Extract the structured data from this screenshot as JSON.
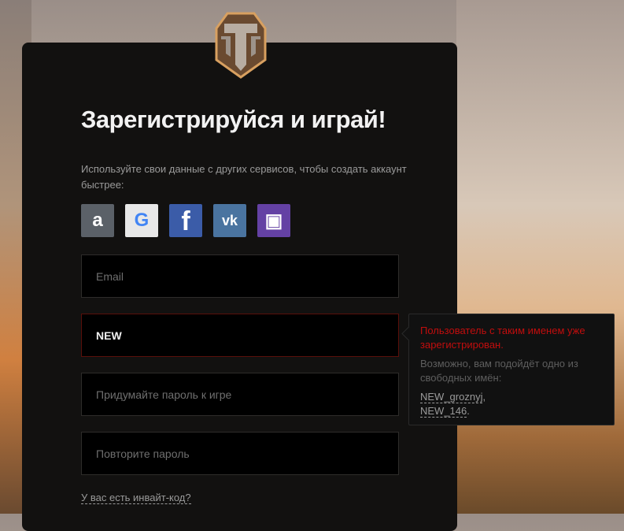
{
  "title": "Зарегистрируйся и играй!",
  "subtitle": "Используйте свои данные с других сервисов, чтобы создать аккаунт быстрее:",
  "social": [
    {
      "name": "amazon",
      "glyph": "a",
      "color": "#5b6168"
    },
    {
      "name": "google",
      "glyph": "G",
      "color": "#e8e8e8"
    },
    {
      "name": "facebook",
      "glyph": "f",
      "color": "#3b5ca8"
    },
    {
      "name": "vk",
      "glyph": "vk",
      "color": "#4a74a0"
    },
    {
      "name": "twitch",
      "glyph": "▣",
      "color": "#6441a4"
    }
  ],
  "form": {
    "email_placeholder": "Email",
    "nickname_value": "NEW",
    "password_placeholder": "Придумайте пароль к игре",
    "repeat_placeholder": "Повторите пароль",
    "invite_link": "У вас есть инвайт-код?"
  },
  "tooltip": {
    "error": "Пользователь с таким именем уже зарегистрирован.",
    "hint": "Возможно, вам подойдёт одно из свободных имён:",
    "suggestions": [
      "NEW_groznyj",
      "NEW_146"
    ]
  }
}
